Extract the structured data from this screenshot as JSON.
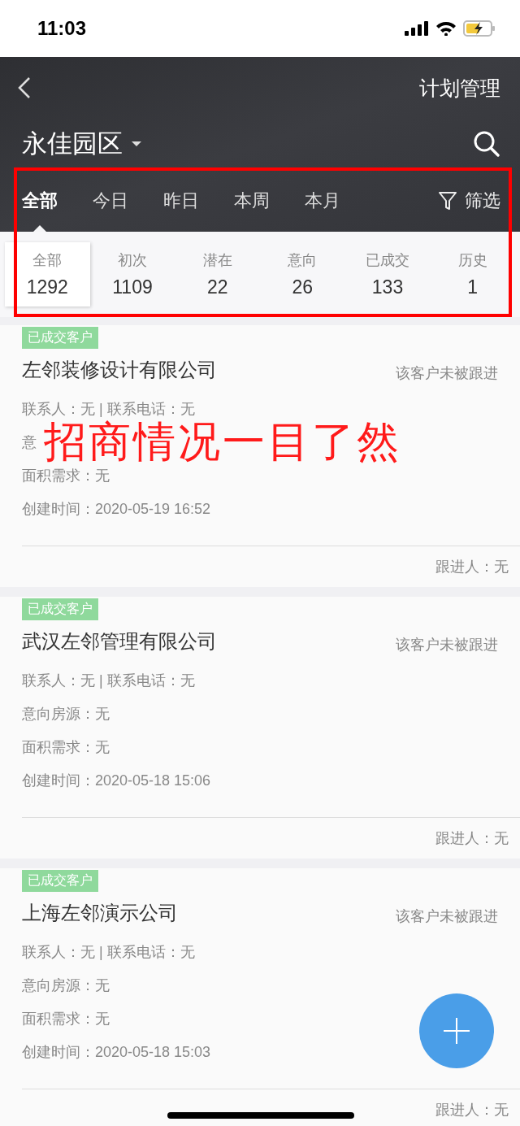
{
  "status_bar": {
    "time": "11:03"
  },
  "nav": {
    "title": "计划管理"
  },
  "park": {
    "name": "永佳园区"
  },
  "tabs": [
    {
      "label": "全部",
      "selected": true
    },
    {
      "label": "今日",
      "selected": false
    },
    {
      "label": "昨日",
      "selected": false
    },
    {
      "label": "本周",
      "selected": false
    },
    {
      "label": "本月",
      "selected": false
    }
  ],
  "filter": {
    "label": "筛选"
  },
  "stats": [
    {
      "label": "全部",
      "count": "1292",
      "selected": true
    },
    {
      "label": "初次",
      "count": "1109",
      "selected": false
    },
    {
      "label": "潜在",
      "count": "22",
      "selected": false
    },
    {
      "label": "意向",
      "count": "26",
      "selected": false
    },
    {
      "label": "已成交",
      "count": "133",
      "selected": false
    },
    {
      "label": "历史",
      "count": "1",
      "selected": false
    }
  ],
  "customers": [
    {
      "tag": "已成交客户",
      "name": "左邻装修设计有限公司",
      "follow_status": "该客户未被跟进",
      "details": [
        "联系人：无 | 联系电话：无",
        "意",
        "面积需求：无",
        "创建时间：2020-05-19 16:52"
      ],
      "follower": "跟进人：无"
    },
    {
      "tag": "已成交客户",
      "name": "武汉左邻管理有限公司",
      "follow_status": "该客户未被跟进",
      "details": [
        "联系人：无 | 联系电话：无",
        "意向房源：无",
        "面积需求：无",
        "创建时间：2020-05-18 15:06"
      ],
      "follower": "跟进人：无"
    },
    {
      "tag": "已成交客户",
      "name": "上海左邻演示公司",
      "follow_status": "该客户未被跟进",
      "details": [
        "联系人：无 | 联系电话：无",
        "意向房源：无",
        "面积需求：无",
        "创建时间：2020-05-18 15:03"
      ],
      "follower": "跟进人：无"
    }
  ],
  "annotation": {
    "caption": "招商情况一目了然"
  }
}
